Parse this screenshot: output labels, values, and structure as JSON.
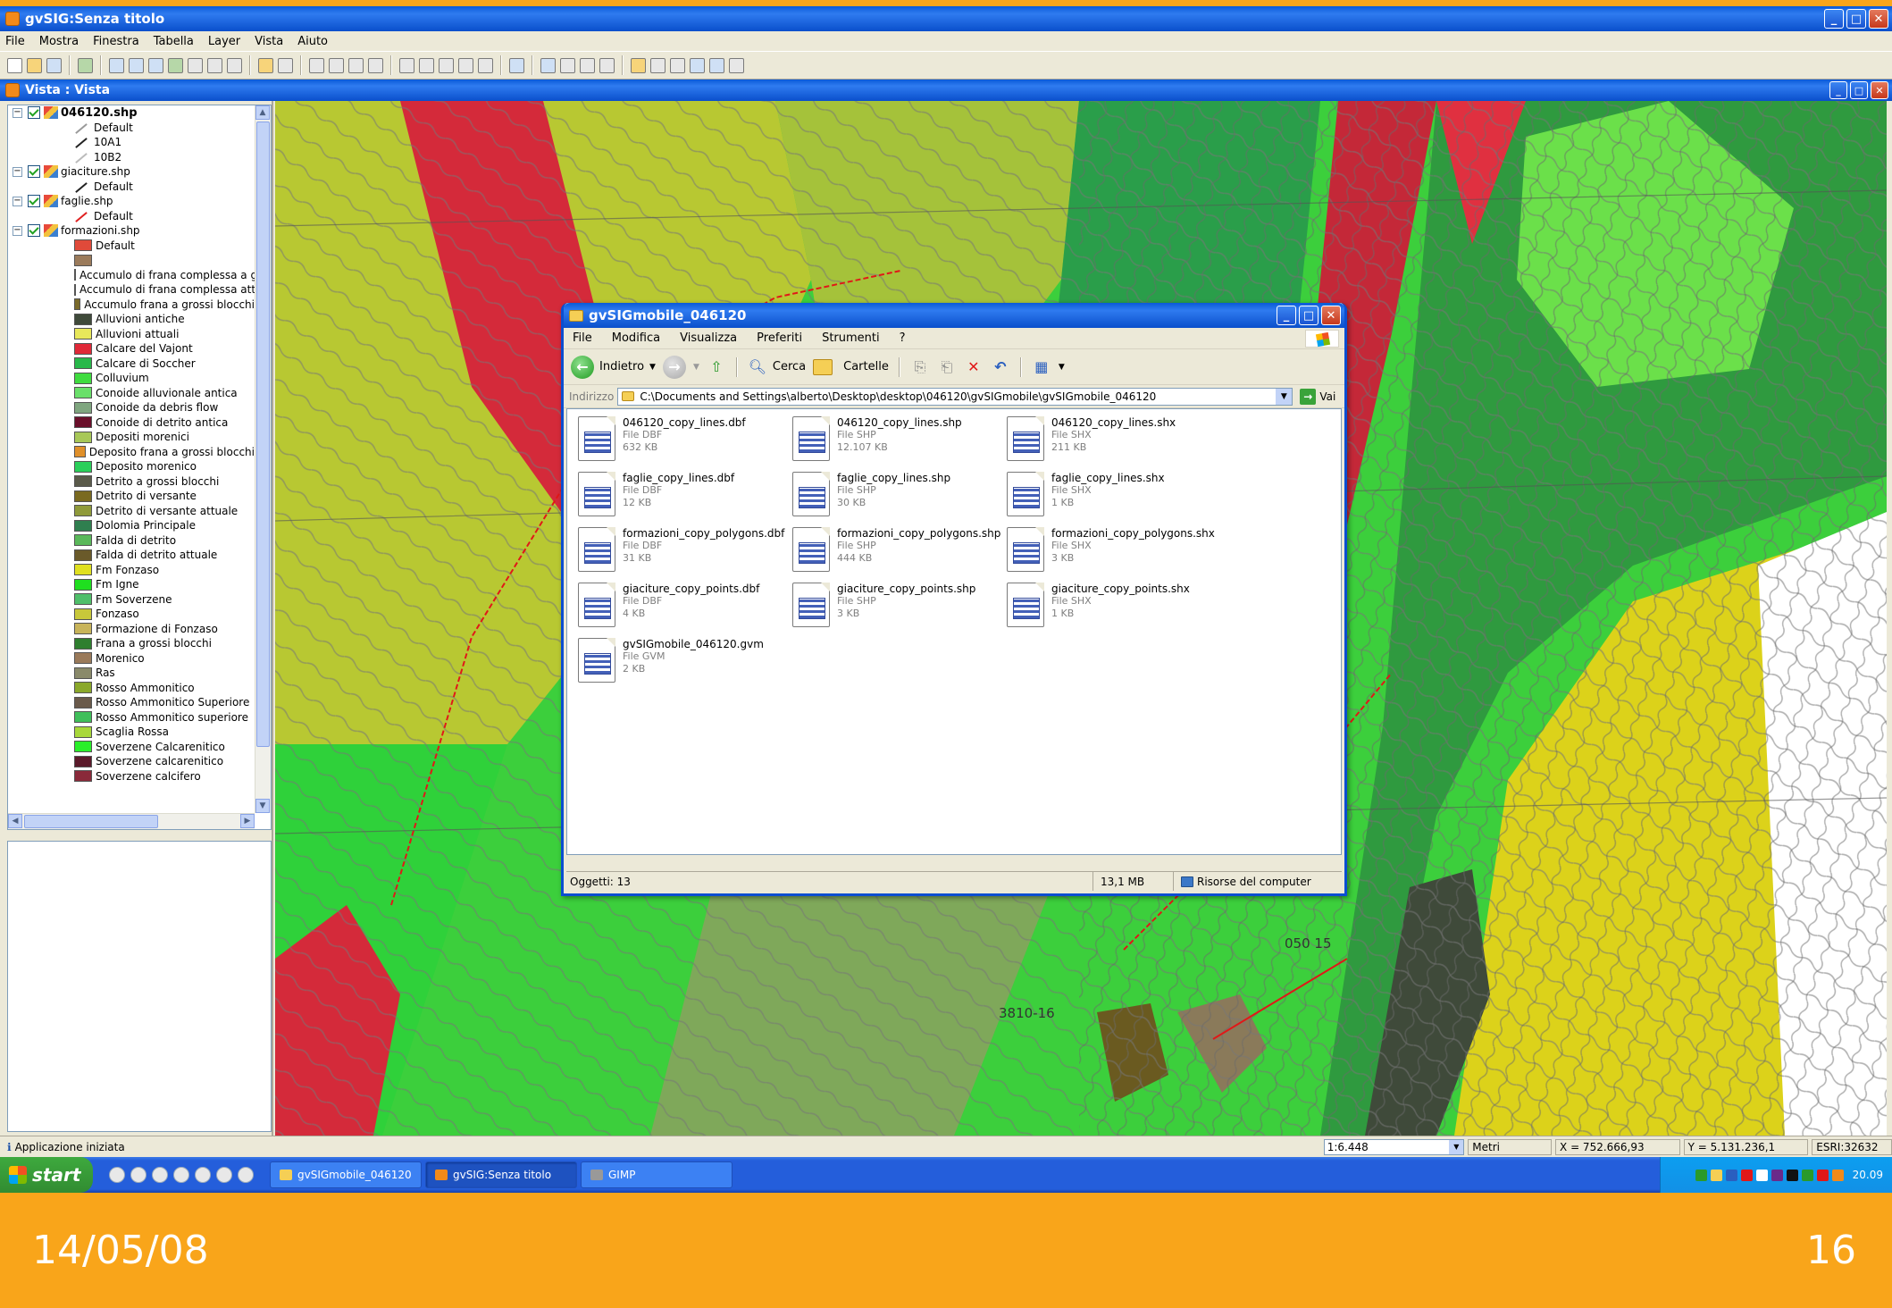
{
  "app": {
    "title": "gvSIG:Senza titolo",
    "menu": [
      "File",
      "Mostra",
      "Finestra",
      "Tabella",
      "Layer",
      "Vista",
      "Aiuto"
    ]
  },
  "view": {
    "title": "Vista : Vista"
  },
  "toc": {
    "layers": [
      {
        "name": "046120.shp",
        "bold": true,
        "legend": [
          {
            "label": "Default",
            "color": "#9a9a9a",
            "kind": "line"
          },
          {
            "label": "10A1",
            "color": "#222222",
            "kind": "line"
          },
          {
            "label": "10B2",
            "color": "#bbbbbb",
            "kind": "line"
          }
        ]
      },
      {
        "name": "giaciture.shp",
        "bold": false,
        "legend": [
          {
            "label": "Default",
            "color": "#222222",
            "kind": "point"
          }
        ]
      },
      {
        "name": "faglie.shp",
        "bold": false,
        "legend": [
          {
            "label": "Default",
            "color": "#e02020",
            "kind": "line"
          }
        ]
      },
      {
        "name": "formazioni.shp",
        "bold": false,
        "legend": [
          {
            "label": "Default",
            "color": "#e04a3a",
            "kind": "fill"
          },
          {
            "label": "",
            "color": "#9b7b5b",
            "kind": "fill"
          },
          {
            "label": "Accumulo di frana complessa a gr",
            "color": "#8f7a55",
            "kind": "fill"
          },
          {
            "label": "Accumulo di frana complessa attu",
            "color": "#8fd35a",
            "kind": "fill"
          },
          {
            "label": "Accumulo frana a grossi blocchi",
            "color": "#7a6a2a",
            "kind": "fill"
          },
          {
            "label": "Alluvioni antiche",
            "color": "#3f4a3a",
            "kind": "fill"
          },
          {
            "label": "Alluvioni attuali",
            "color": "#e8e85a",
            "kind": "fill"
          },
          {
            "label": "Calcare del Vajont",
            "color": "#e02838",
            "kind": "fill"
          },
          {
            "label": "Calcare di Soccher",
            "color": "#28b84a",
            "kind": "fill"
          },
          {
            "label": "Colluvium",
            "color": "#3fdc3f",
            "kind": "fill"
          },
          {
            "label": "Conoide alluvionale antica",
            "color": "#6ae06a",
            "kind": "fill"
          },
          {
            "label": "Conoide da debris flow",
            "color": "#7fa67f",
            "kind": "fill"
          },
          {
            "label": "Conoide di detrito antica",
            "color": "#6a0f2a",
            "kind": "fill"
          },
          {
            "label": "Depositi morenici",
            "color": "#a8c858",
            "kind": "fill"
          },
          {
            "label": "Deposito frana a grossi blocchi",
            "color": "#e0902a",
            "kind": "fill"
          },
          {
            "label": "Deposito morenico",
            "color": "#2acf5a",
            "kind": "fill"
          },
          {
            "label": "Detrito a grossi blocchi",
            "color": "#5a5a4a",
            "kind": "fill"
          },
          {
            "label": "Detrito di versante",
            "color": "#7a6a20",
            "kind": "fill"
          },
          {
            "label": "Detrito di versante attuale",
            "color": "#8f9a3a",
            "kind": "fill"
          },
          {
            "label": "Dolomia Principale",
            "color": "#2f7f4f",
            "kind": "fill"
          },
          {
            "label": "Falda di detrito",
            "color": "#5ab85a",
            "kind": "fill"
          },
          {
            "label": "Falda di detrito attuale",
            "color": "#6a5a2a",
            "kind": "fill"
          },
          {
            "label": "Fm Fonzaso",
            "color": "#e0e020",
            "kind": "fill"
          },
          {
            "label": "Fm Igne",
            "color": "#1fdf1f",
            "kind": "fill"
          },
          {
            "label": "Fm Soverzene",
            "color": "#4fbf6a",
            "kind": "fill"
          },
          {
            "label": "Fonzaso",
            "color": "#c8c83a",
            "kind": "fill"
          },
          {
            "label": "Formazione di Fonzaso",
            "color": "#c8b45a",
            "kind": "fill"
          },
          {
            "label": "Frana a grossi blocchi",
            "color": "#2f7f2f",
            "kind": "fill"
          },
          {
            "label": "Morenico",
            "color": "#9a7a5a",
            "kind": "fill"
          },
          {
            "label": "Ras",
            "color": "#8a8a6a",
            "kind": "fill"
          },
          {
            "label": "Rosso Ammonitico",
            "color": "#8aa82a",
            "kind": "fill"
          },
          {
            "label": "Rosso Ammonitico Superiore",
            "color": "#6a5a4a",
            "kind": "fill"
          },
          {
            "label": "Rosso Ammonitico superiore",
            "color": "#3fbf5a",
            "kind": "fill"
          },
          {
            "label": "Scaglia Rossa",
            "color": "#a8d83a",
            "kind": "fill"
          },
          {
            "label": "Soverzene Calcarenitico",
            "color": "#2aef2a",
            "kind": "fill"
          },
          {
            "label": "Soverzene calcarenitico",
            "color": "#5a1a2a",
            "kind": "fill"
          },
          {
            "label": "Soverzene calcifero",
            "color": "#8a2a3a",
            "kind": "fill"
          }
        ]
      }
    ]
  },
  "explorer": {
    "title": "gvSIGmobile_046120",
    "menu": [
      "File",
      "Modifica",
      "Visualizza",
      "Preferiti",
      "Strumenti",
      "?"
    ],
    "toolbar": {
      "back": "Indietro",
      "search": "Cerca",
      "folders": "Cartelle"
    },
    "address_label": "Indirizzo",
    "address": "C:\\Documents and Settings\\alberto\\Desktop\\desktop\\046120\\gvSIGmobile\\gvSIGmobile_046120",
    "go": "Vai",
    "files": [
      {
        "name": "046120_copy_lines.dbf",
        "type": "File DBF",
        "size": "632 KB"
      },
      {
        "name": "046120_copy_lines.shp",
        "type": "File SHP",
        "size": "12.107 KB"
      },
      {
        "name": "046120_copy_lines.shx",
        "type": "File SHX",
        "size": "211 KB"
      },
      {
        "name": "faglie_copy_lines.dbf",
        "type": "File DBF",
        "size": "12 KB"
      },
      {
        "name": "faglie_copy_lines.shp",
        "type": "File SHP",
        "size": "30 KB"
      },
      {
        "name": "faglie_copy_lines.shx",
        "type": "File SHX",
        "size": "1 KB"
      },
      {
        "name": "formazioni_copy_polygons.dbf",
        "type": "File DBF",
        "size": "31 KB"
      },
      {
        "name": "formazioni_copy_polygons.shp",
        "type": "File SHP",
        "size": "444 KB"
      },
      {
        "name": "formazioni_copy_polygons.shx",
        "type": "File SHX",
        "size": "3 KB"
      },
      {
        "name": "giaciture_copy_points.dbf",
        "type": "File DBF",
        "size": "4 KB"
      },
      {
        "name": "giaciture_copy_points.shp",
        "type": "File SHP",
        "size": "3 KB"
      },
      {
        "name": "giaciture_copy_points.shx",
        "type": "File SHX",
        "size": "1 KB"
      },
      {
        "name": "gvSIGmobile_046120.gvm",
        "type": "File GVM",
        "size": "2 KB"
      }
    ],
    "status": {
      "objects": "Oggetti: 13",
      "size": "13,1 MB",
      "location": "Risorse del computer"
    }
  },
  "map": {
    "labels": [
      "050 15",
      "3810-16"
    ]
  },
  "statusbar": {
    "message": "Applicazione iniziata",
    "scale": "1:6.448",
    "units": "Metri",
    "x": "X = 752.666,93",
    "y": "Y = 5.131.236,1",
    "crs": "ESRI:32632"
  },
  "taskbar": {
    "start": "start",
    "tasks": [
      "gvSIGmobile_046120",
      "gvSIG:Senza titolo",
      "GIMP"
    ],
    "clock": "20.09"
  },
  "slide": {
    "date": "14/05/08",
    "page": "16"
  }
}
